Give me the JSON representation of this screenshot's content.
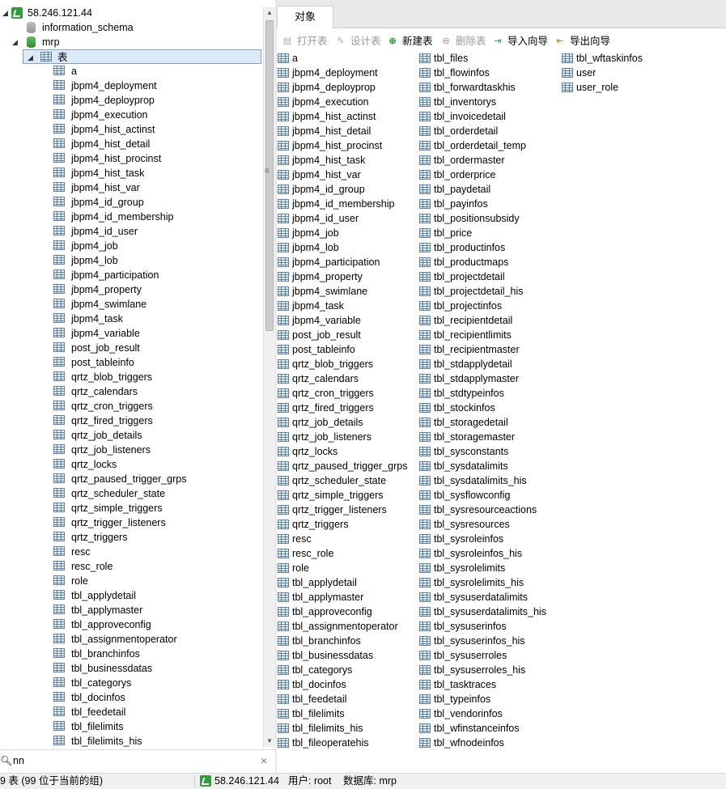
{
  "tree": {
    "connection": "58.246.121.44",
    "databases": [
      "information_schema",
      "mrp"
    ],
    "tables_node": "表",
    "tables": [
      "a",
      "jbpm4_deployment",
      "jbpm4_deployprop",
      "jbpm4_execution",
      "jbpm4_hist_actinst",
      "jbpm4_hist_detail",
      "jbpm4_hist_procinst",
      "jbpm4_hist_task",
      "jbpm4_hist_var",
      "jbpm4_id_group",
      "jbpm4_id_membership",
      "jbpm4_id_user",
      "jbpm4_job",
      "jbpm4_lob",
      "jbpm4_participation",
      "jbpm4_property",
      "jbpm4_swimlane",
      "jbpm4_task",
      "jbpm4_variable",
      "post_job_result",
      "post_tableinfo",
      "qrtz_blob_triggers",
      "qrtz_calendars",
      "qrtz_cron_triggers",
      "qrtz_fired_triggers",
      "qrtz_job_details",
      "qrtz_job_listeners",
      "qrtz_locks",
      "qrtz_paused_trigger_grps",
      "qrtz_scheduler_state",
      "qrtz_simple_triggers",
      "qrtz_trigger_listeners",
      "qrtz_triggers",
      "resc",
      "resc_role",
      "role",
      "tbl_applydetail",
      "tbl_applymaster",
      "tbl_approveconfig",
      "tbl_assignmentoperator",
      "tbl_branchinfos",
      "tbl_businessdatas",
      "tbl_categorys",
      "tbl_docinfos",
      "tbl_feedetail",
      "tbl_filelimits",
      "tbl_filelimits_his"
    ]
  },
  "search": {
    "value": "nn",
    "clear": "×"
  },
  "tab": {
    "label": "对象"
  },
  "toolbar": {
    "open": "打开表",
    "design": "设计表",
    "new": "新建表",
    "delete": "删除表",
    "import": "导入向导",
    "export": "导出向导"
  },
  "objects": {
    "col1": [
      "a",
      "jbpm4_deployment",
      "jbpm4_deployprop",
      "jbpm4_execution",
      "jbpm4_hist_actinst",
      "jbpm4_hist_detail",
      "jbpm4_hist_procinst",
      "jbpm4_hist_task",
      "jbpm4_hist_var",
      "jbpm4_id_group",
      "jbpm4_id_membership",
      "jbpm4_id_user",
      "jbpm4_job",
      "jbpm4_lob",
      "jbpm4_participation",
      "jbpm4_property",
      "jbpm4_swimlane",
      "jbpm4_task",
      "jbpm4_variable",
      "post_job_result",
      "post_tableinfo",
      "qrtz_blob_triggers",
      "qrtz_calendars",
      "qrtz_cron_triggers",
      "qrtz_fired_triggers",
      "qrtz_job_details",
      "qrtz_job_listeners",
      "qrtz_locks",
      "qrtz_paused_trigger_grps",
      "qrtz_scheduler_state",
      "qrtz_simple_triggers",
      "qrtz_trigger_listeners",
      "qrtz_triggers",
      "resc",
      "resc_role",
      "role",
      "tbl_applydetail",
      "tbl_applymaster",
      "tbl_approveconfig",
      "tbl_assignmentoperator",
      "tbl_branchinfos",
      "tbl_businessdatas",
      "tbl_categorys",
      "tbl_docinfos",
      "tbl_feedetail",
      "tbl_filelimits",
      "tbl_filelimits_his",
      "tbl_fileoperatehis"
    ],
    "col2": [
      "tbl_files",
      "tbl_flowinfos",
      "tbl_forwardtaskhis",
      "tbl_inventorys",
      "tbl_invoicedetail",
      "tbl_orderdetail",
      "tbl_orderdetail_temp",
      "tbl_ordermaster",
      "tbl_orderprice",
      "tbl_paydetail",
      "tbl_payinfos",
      "tbl_positionsubsidy",
      "tbl_price",
      "tbl_productinfos",
      "tbl_productmaps",
      "tbl_projectdetail",
      "tbl_projectdetail_his",
      "tbl_projectinfos",
      "tbl_recipientdetail",
      "tbl_recipientlimits",
      "tbl_recipientmaster",
      "tbl_stdapplydetail",
      "tbl_stdapplymaster",
      "tbl_stdtypeinfos",
      "tbl_stockinfos",
      "tbl_storagedetail",
      "tbl_storagemaster",
      "tbl_sysconstants",
      "tbl_sysdatalimits",
      "tbl_sysdatalimits_his",
      "tbl_sysflowconfig",
      "tbl_sysresourceactions",
      "tbl_sysresources",
      "tbl_sysroleinfos",
      "tbl_sysroleinfos_his",
      "tbl_sysrolelimits",
      "tbl_sysrolelimits_his",
      "tbl_sysuserdatalimits",
      "tbl_sysuserdatalimits_his",
      "tbl_sysuserinfos",
      "tbl_sysuserinfos_his",
      "tbl_sysuserroles",
      "tbl_sysuserroles_his",
      "tbl_tasktraces",
      "tbl_typeinfos",
      "tbl_vendorinfos",
      "tbl_wfinstanceinfos",
      "tbl_wfnodeinfos"
    ],
    "col3": [
      "tbl_wftaskinfos",
      "user",
      "user_role"
    ]
  },
  "status": {
    "count": "9 表 (99 位于当前的组)",
    "connection": "58.246.121.44",
    "user": "用户: root",
    "database": "数据库: mrp"
  },
  "colors": {
    "accent": "#2e9d3a",
    "selection": "#dce9f8",
    "icon_blue": "#5a7fb3"
  }
}
